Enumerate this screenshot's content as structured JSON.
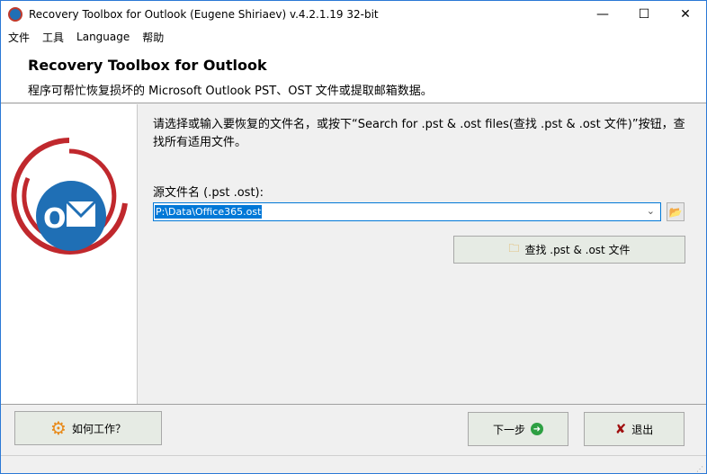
{
  "window": {
    "title": "Recovery Toolbox for Outlook (Eugene Shiriaev) v.4.2.1.19 32-bit",
    "minimize": "—",
    "maximize": "☐",
    "close": "✕"
  },
  "menu": [
    "文件",
    "工具",
    "Language",
    "帮助"
  ],
  "header": {
    "title": "Recovery Toolbox for Outlook",
    "subtitle": "程序可帮忙恢复损坏的 Microsoft Outlook PST、OST 文件或提取邮箱数据。"
  },
  "main": {
    "description": "请选择或输入要恢复的文件名，或按下“Search for .pst & .ost files(查找 .pst & .ost 文件)”按钮，查找所有适用文件。",
    "source_label": "源文件名 (.pst .ost):",
    "source_value": "P:\\Data\\Office365.ost",
    "search_button": "查找 .pst & .ost 文件"
  },
  "footer": {
    "how_button": "如何工作？",
    "next_button": "下一步",
    "exit_button": "退出"
  },
  "colors": {
    "accent": "#0078d7",
    "logo_red": "#c0282d",
    "logo_blue": "#1f6fb5"
  }
}
